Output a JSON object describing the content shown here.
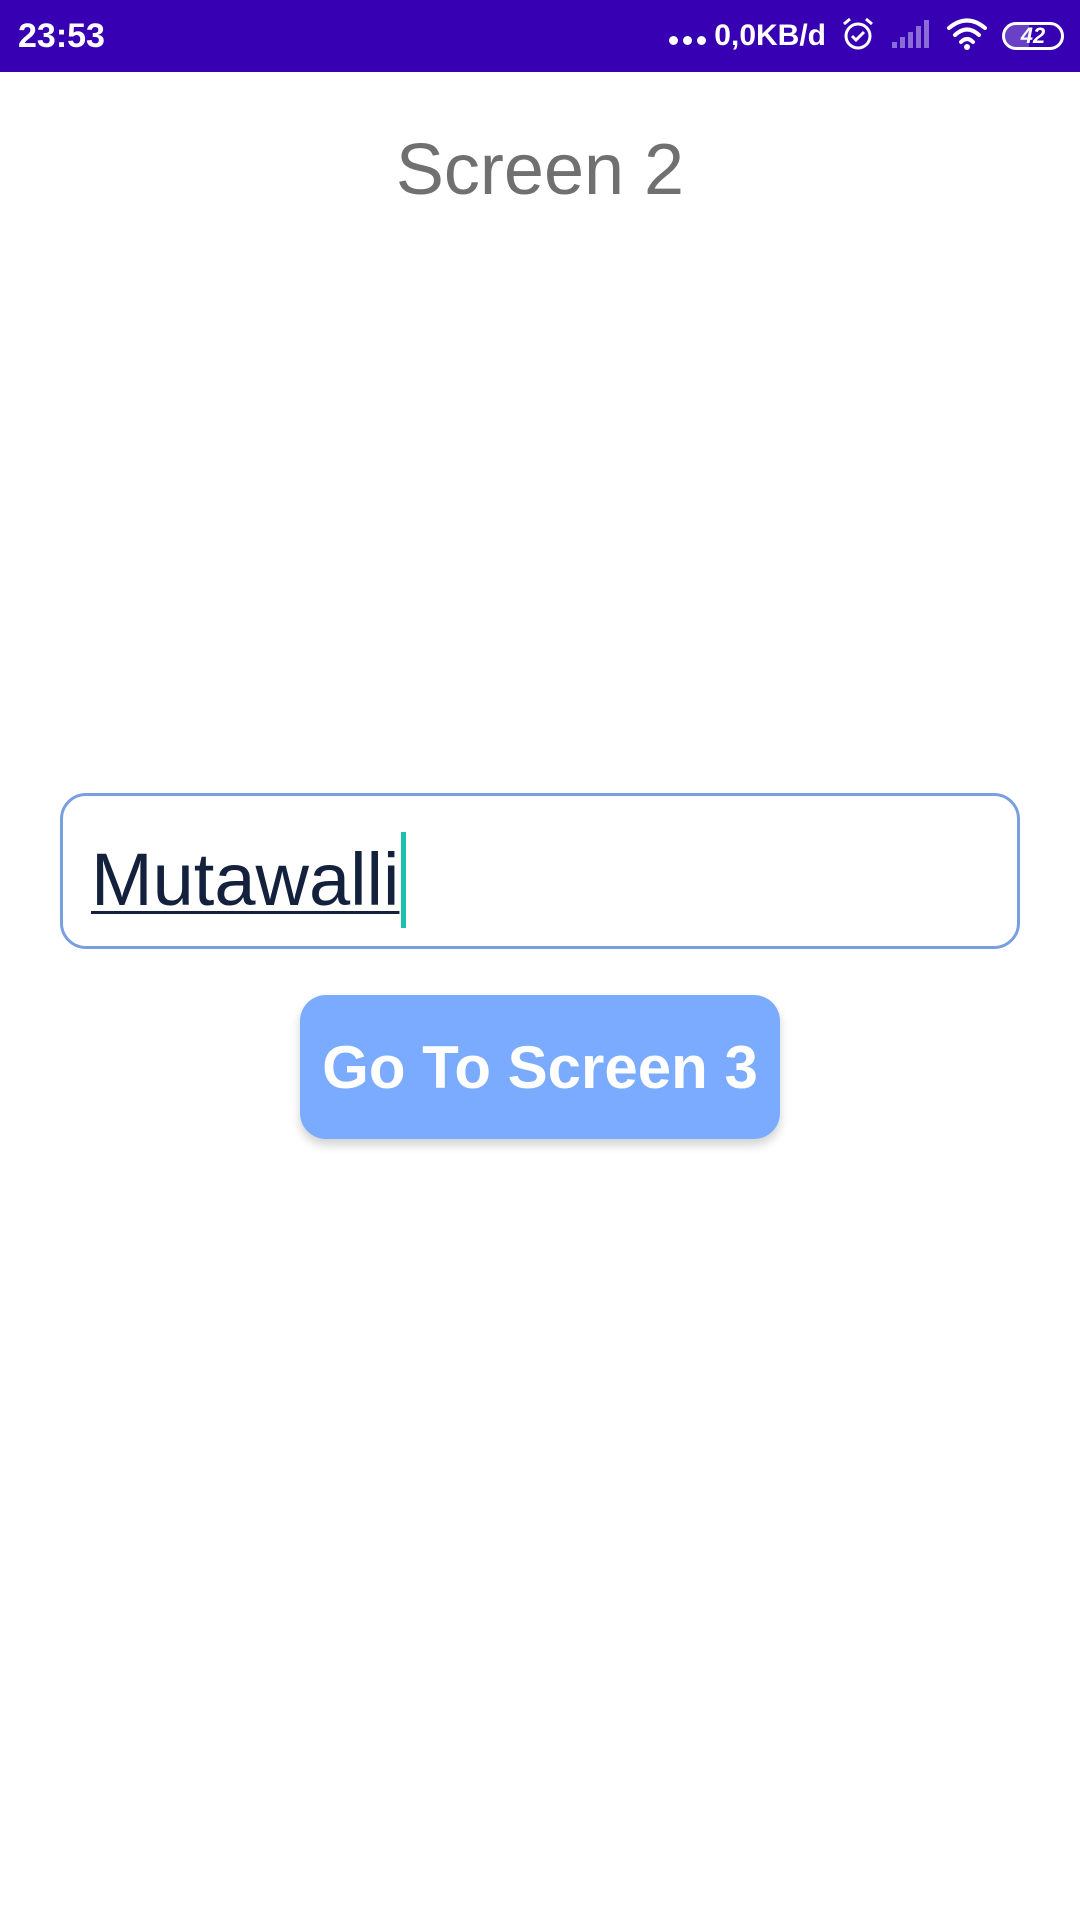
{
  "status_bar": {
    "time": "23:53",
    "net_speed": "0,0KB/d",
    "battery_level": "42",
    "background_color": "#3700b3",
    "icons": [
      "more-dots-icon",
      "alarm-icon",
      "cellular-signal-icon",
      "wifi-icon",
      "battery-icon"
    ]
  },
  "main": {
    "title": "Screen 2",
    "name_input": {
      "value": "Mutawalli"
    },
    "go_button_label": "Go To Screen 3",
    "accent_color": "#7aabff"
  }
}
